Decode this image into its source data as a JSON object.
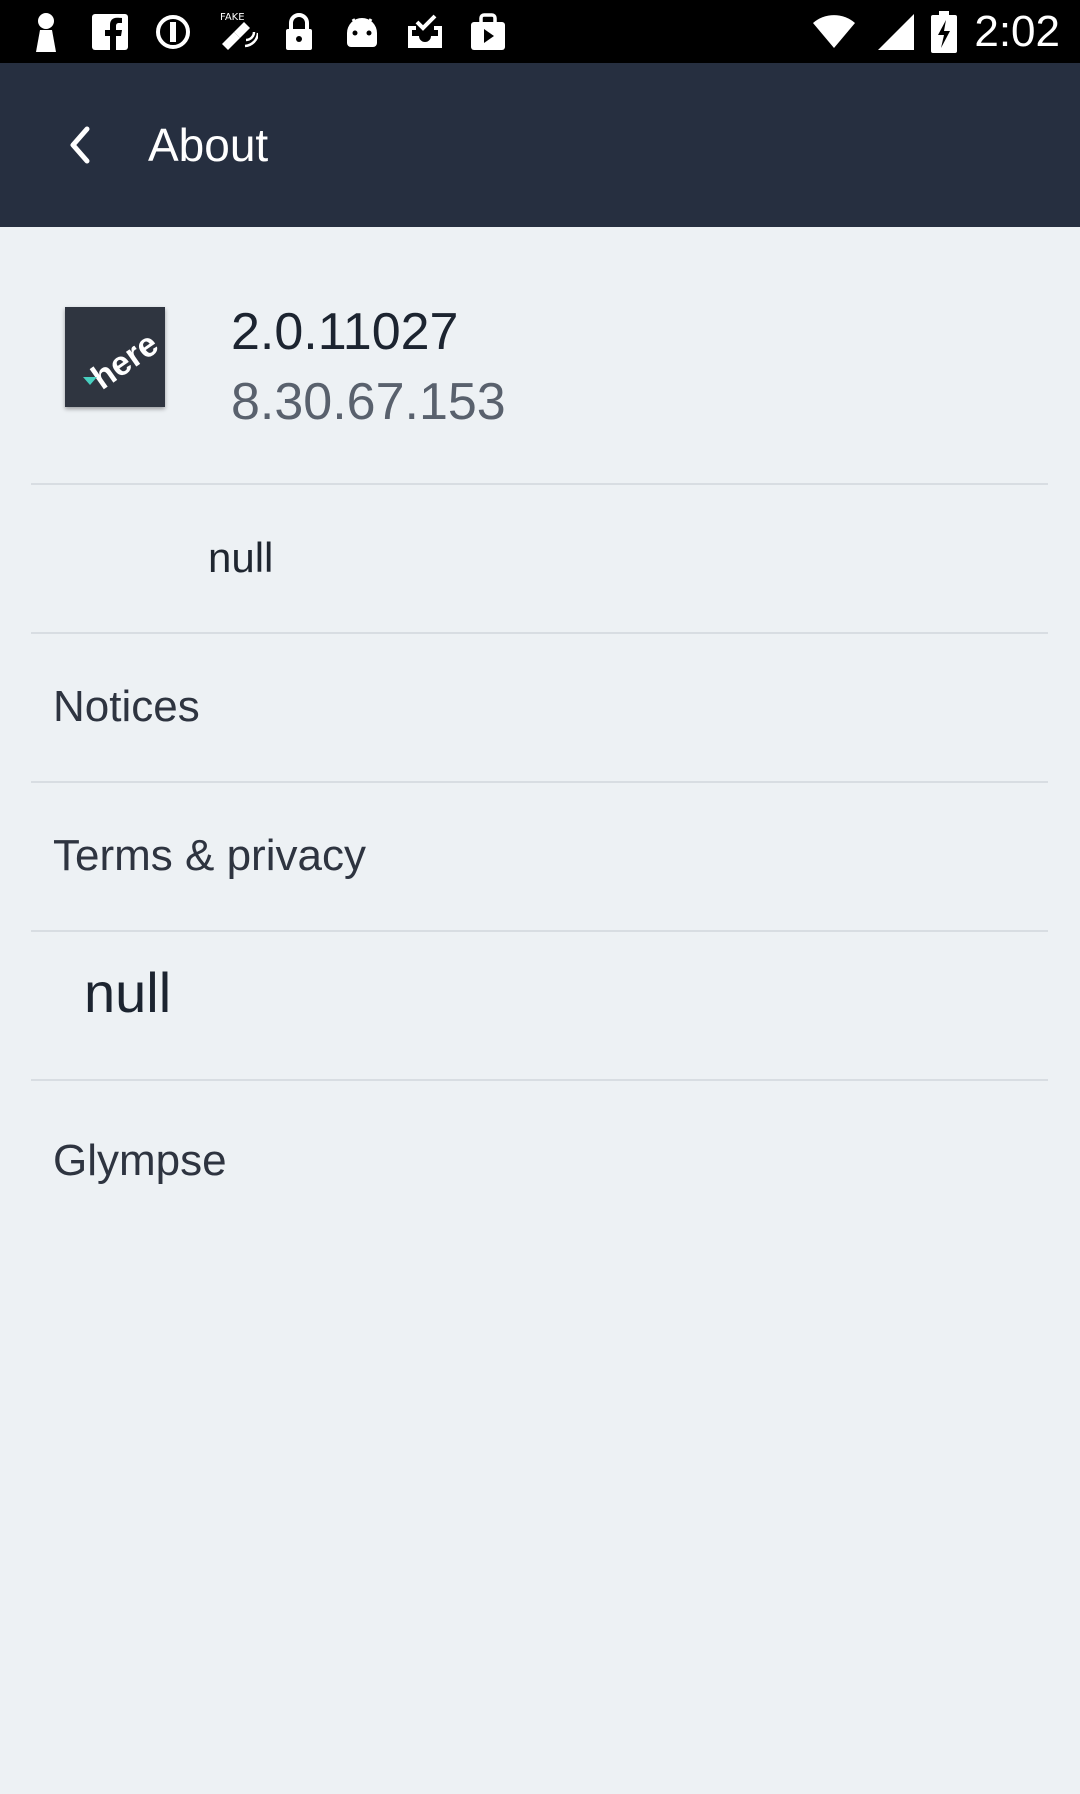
{
  "status_bar": {
    "time": "2:02",
    "icons": [
      "person-icon",
      "facebook-icon",
      "blocked-icon",
      "fake-gps-icon",
      "lock-icon",
      "android-icon",
      "inbox-check-icon",
      "play-store-icon",
      "wifi-icon",
      "signal-icon",
      "battery-charging-icon"
    ]
  },
  "app_bar": {
    "title": "About",
    "background": "#262f40"
  },
  "header": {
    "logo_text": "here",
    "version_primary": "2.0.11027",
    "version_secondary": "8.30.67.153"
  },
  "items": [
    {
      "label": "null"
    },
    {
      "label": "Notices"
    },
    {
      "label": "Terms & privacy"
    },
    {
      "label": "null"
    },
    {
      "label": "Glympse"
    }
  ]
}
